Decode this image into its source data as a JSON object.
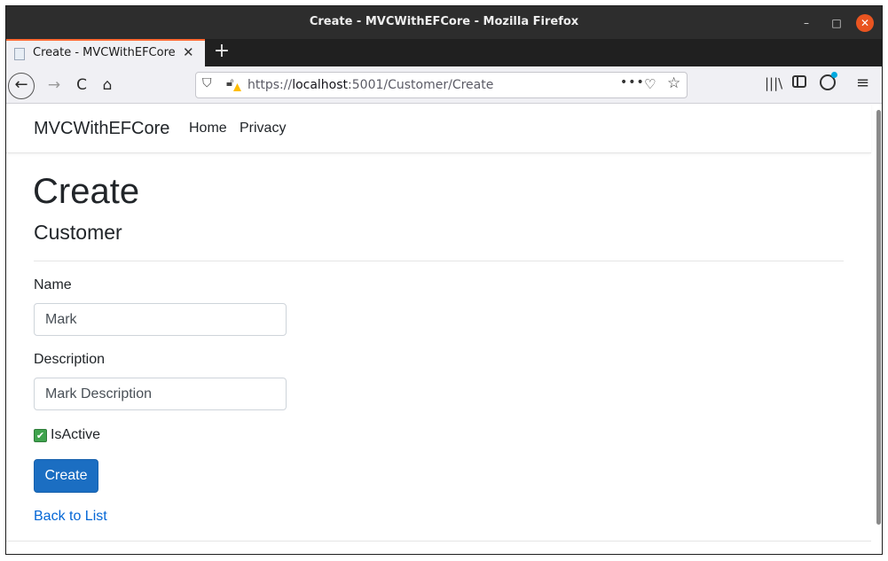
{
  "window": {
    "title": "Create - MVCWithEFCore - Mozilla Firefox",
    "controls": {
      "minimize": "–",
      "maximize": "□",
      "close": "✕"
    }
  },
  "tabs": [
    {
      "label": "Create - MVCWithEFCore",
      "close": "✕",
      "active": true
    }
  ],
  "toolbar": {
    "new_tab": "+",
    "back": "←",
    "forward": "→",
    "reload": "C",
    "home": "⌂",
    "url_prefix": "https://",
    "url_host": "localhost",
    "url_rest": ":5001/Customer/Create",
    "page_actions": "•••",
    "pocket": "♡",
    "bookmark": "☆",
    "library": "|||\\",
    "menu": "≡"
  },
  "site": {
    "brand": "MVCWithEFCore",
    "nav": [
      "Home",
      "Privacy"
    ]
  },
  "page": {
    "heading": "Create",
    "subheading": "Customer",
    "fields": [
      {
        "label": "Name",
        "value": "Mark"
      },
      {
        "label": "Description",
        "value": "Mark Description"
      }
    ],
    "checkbox": {
      "label": "IsActive",
      "checked": true,
      "mark": "✔"
    },
    "submit_label": "Create",
    "back_link": "Back to List"
  },
  "colors": {
    "primary_button": "#1b6ec2",
    "link": "#0366d6",
    "tab_accent": "#ff6a33",
    "close_button": "#e95420",
    "checkbox": "#3fa34d"
  }
}
